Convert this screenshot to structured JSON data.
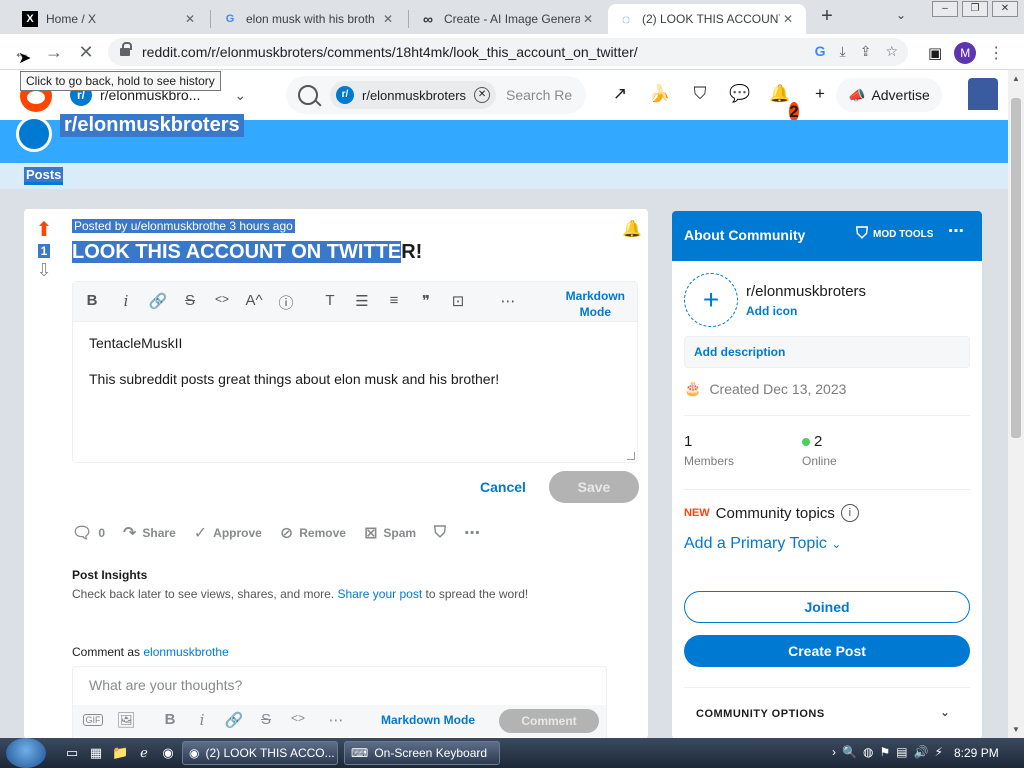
{
  "browser": {
    "tabs": [
      {
        "favicon": "X",
        "title": "Home / X",
        "close": "✕"
      },
      {
        "favicon": "G",
        "title": "elon musk with his broth",
        "close": "✕"
      },
      {
        "favicon": "∞",
        "title": "Create - AI Image Genera",
        "close": "✕"
      },
      {
        "favicon": "◌",
        "title": "(2) LOOK THIS ACCOUNT",
        "close": "✕"
      }
    ],
    "new_tab": "+",
    "tab_menu": "⌄",
    "url": "reddit.com/r/elonmuskbroters/comments/18ht4mk/look_this_account_on_twitter/",
    "profile_initial": "M",
    "tooltip": "Click to go back, hold to see history"
  },
  "header": {
    "subreddit_short": "r/elonmuskbro...",
    "search_chip": "r/elonmuskbroters",
    "search_placeholder": "Search Re",
    "notification_count": "2",
    "advertise": "Advertise"
  },
  "banner": {
    "subreddit": "r/elonmuskbroters",
    "tab_posts": "Posts"
  },
  "post": {
    "vote_count": "1",
    "meta_prefix": "Posted by ",
    "meta_user": "u/elonmuskbrothe",
    "meta_time": " 3 hours ago",
    "title_selected": "LOOK THIS ACCOUNT ON TWITTE",
    "title_rest": "R!",
    "markdown_mode_1": "Markdown",
    "markdown_mode_2": "Mode",
    "body_line1": "TentacleMuskII",
    "body_line2": "This subreddit posts great things about elon musk and his brother!",
    "cancel": "Cancel",
    "save": "Save",
    "comments_count": "0",
    "share": "Share",
    "approve": "Approve",
    "remove": "Remove",
    "spam": "Spam",
    "insights_title": "Post Insights",
    "insights_text_a": "Check back later to see views, shares, and more. ",
    "insights_link": "Share your post",
    "insights_text_b": " to spread the word!",
    "comment_as": "Comment as ",
    "comment_user": "elonmuskbrothe",
    "comment_placeholder": "What are your thoughts?",
    "comment_markdown": "Markdown Mode",
    "comment_button": "Comment"
  },
  "sidebar": {
    "title": "About Community",
    "mod_tools": "MOD TOOLS",
    "subreddit": "r/elonmuskbroters",
    "add_icon": "Add icon",
    "add_description": "Add description",
    "created": "Created Dec 13, 2023",
    "members_count": "1",
    "members_label": "Members",
    "online_count": "2",
    "online_label": "Online",
    "new_badge": "NEW",
    "community_topics": "Community topics",
    "add_topic": "Add a Primary Topic",
    "joined": "Joined",
    "create_post": "Create Post",
    "community_options": "COMMUNITY OPTIONS"
  },
  "taskbar": {
    "chrome_task": "(2) LOOK THIS ACCO...",
    "keyboard_task": "On-Screen Keyboard",
    "time": "8:29 PM"
  },
  "colors": {
    "reddit_orange": "#ff4500",
    "reddit_blue": "#0079d3",
    "banner_blue": "#33a8ff",
    "selection": "#3a78c9"
  }
}
